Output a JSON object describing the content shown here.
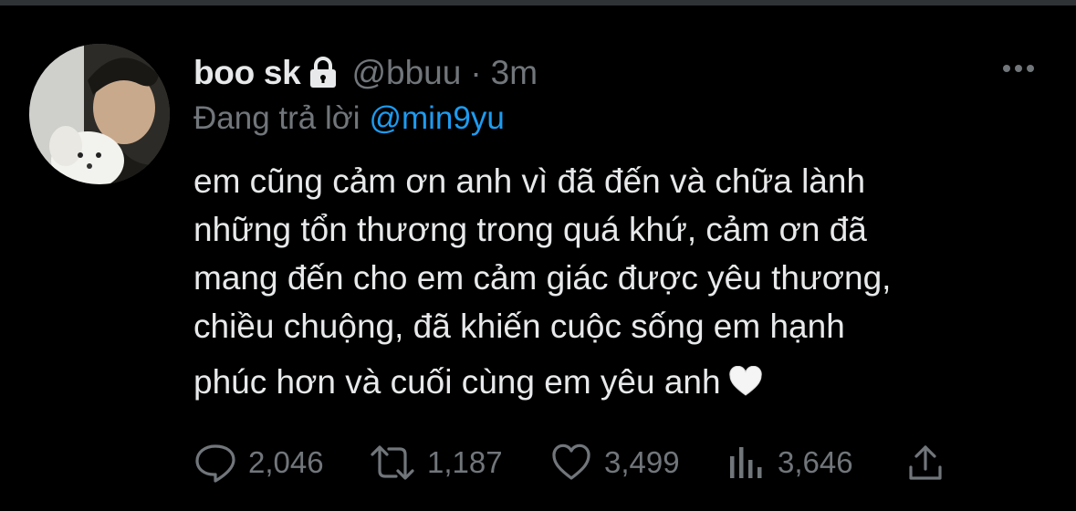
{
  "tweet": {
    "display_name": "boo sk",
    "handle": "@bbuu",
    "separator": "·",
    "time": "3m",
    "reply_prefix": "Đang trả lời",
    "reply_to": "@min9yu",
    "text_lines": [
      "em cũng cảm ơn anh vì đã đến và chữa lành",
      "những tổn thương trong quá khứ, cảm ơn đã",
      "mang đến cho em cảm giác được yêu thương,",
      "chiều chuộng, đã khiến cuộc sống em hạnh",
      "phúc hơn và cuối cùng em yêu anh"
    ],
    "emoji": "white-heart"
  },
  "actions": {
    "replies": "2,046",
    "retweets": "1,187",
    "likes": "3,499",
    "views": "3,646"
  },
  "icons": {
    "lock": "lock-icon",
    "more": "more-icon",
    "reply": "reply-icon",
    "retweet": "retweet-icon",
    "like": "heart-icon",
    "views": "analytics-icon",
    "share": "share-icon"
  },
  "colors": {
    "background": "#000000",
    "text": "#e7e9ea",
    "muted": "#71767b",
    "link": "#1d9bf0"
  }
}
